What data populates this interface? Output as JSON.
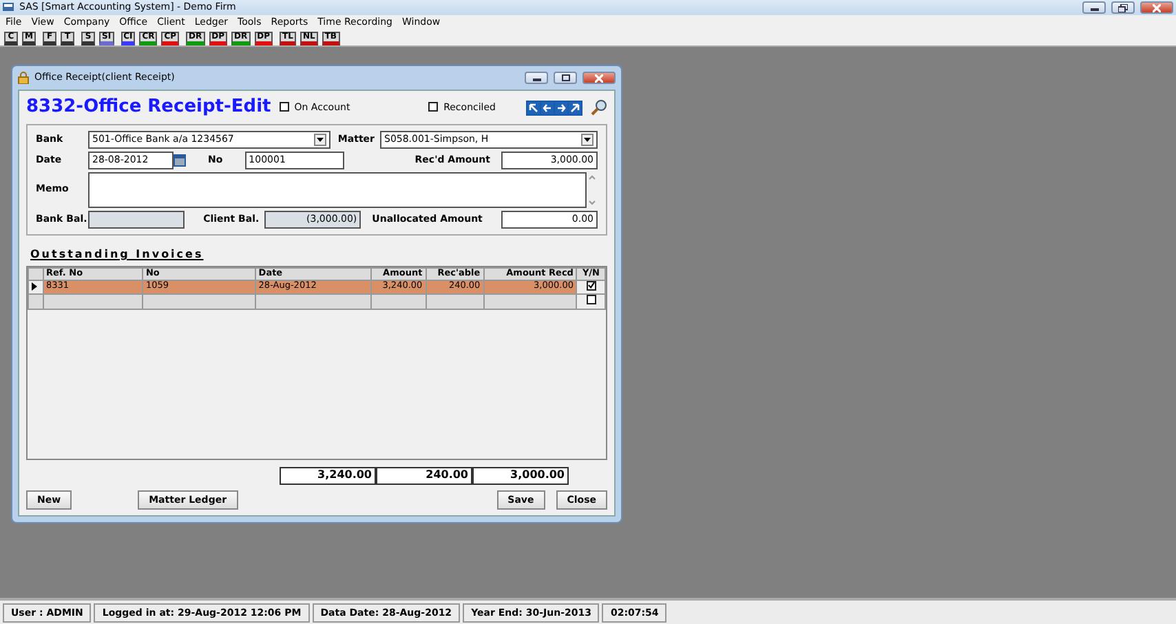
{
  "app_title": "SAS [Smart Accounting System] - Demo Firm",
  "menu": [
    "File",
    "View",
    "Company",
    "Office",
    "Client",
    "Ledger",
    "Tools",
    "Reports",
    "Time Recording",
    "Window"
  ],
  "toolbar_groups": [
    [
      {
        "label": "C",
        "color": "#333333"
      },
      {
        "label": "M",
        "color": "#333333"
      }
    ],
    [
      {
        "label": "F",
        "color": "#333333"
      },
      {
        "label": "T",
        "color": "#333333"
      }
    ],
    [
      {
        "label": "S",
        "color": "#333333"
      },
      {
        "label": "SI",
        "color": "#6a6ad0"
      }
    ],
    [
      {
        "label": "CI",
        "color": "#3a3aff"
      },
      {
        "label": "CR",
        "color": "#109a10"
      },
      {
        "label": "CP",
        "color": "#e01010"
      }
    ],
    [
      {
        "label": "DR",
        "color": "#109a10"
      },
      {
        "label": "DP",
        "color": "#e01010"
      },
      {
        "label": "DR",
        "color": "#109a10"
      },
      {
        "label": "DP",
        "color": "#e01010"
      }
    ],
    [
      {
        "label": "TL",
        "color": "#c01010"
      },
      {
        "label": "NL",
        "color": "#c01010"
      },
      {
        "label": "TB",
        "color": "#c01010"
      }
    ]
  ],
  "dialog": {
    "title": "Office Receipt(client Receipt)",
    "heading": "8332-Office Receipt-Edit",
    "on_account": {
      "label": "On Account",
      "checked": false
    },
    "reconciled": {
      "label": "Reconciled",
      "checked": false
    },
    "bank": {
      "label": "Bank",
      "value": "501-Office Bank a/a 1234567"
    },
    "matter": {
      "label": "Matter",
      "value": "S058.001-Simpson, H"
    },
    "date": {
      "label": "Date",
      "value": "28-08-2012"
    },
    "no": {
      "label": "No",
      "value": "100001"
    },
    "recd_amount": {
      "label": "Rec'd Amount",
      "value": "3,000.00"
    },
    "memo": {
      "label": "Memo"
    },
    "bank_bal": {
      "label": "Bank Bal."
    },
    "client_bal": {
      "label": "Client Bal.",
      "value": "(3,000.00)"
    },
    "unallocated": {
      "label": "Unallocated Amount",
      "value": "0.00"
    },
    "section_title": "Outstanding Invoices",
    "table": {
      "columns": [
        "Ref. No",
        "No",
        "Date",
        "Amount",
        "Rec'able",
        "Amount Recd",
        "Y/N"
      ],
      "rows": [
        {
          "cells": [
            "8331",
            "1059",
            "28-Aug-2012",
            "3,240.00",
            "240.00",
            "3,000.00"
          ],
          "checked": true,
          "selected": true
        },
        {
          "cells": [
            "",
            "",
            "",
            "",
            "",
            ""
          ],
          "checked": false,
          "selected": false
        }
      ]
    },
    "totals": [
      "3,240.00",
      "240.00",
      "3,000.00"
    ],
    "buttons_left": [
      "New",
      "Matter Ledger"
    ],
    "buttons_right": [
      "Save",
      "Close"
    ]
  },
  "status_bar": [
    "User : ADMIN",
    "Logged in at: 29-Aug-2012 12:06 PM",
    "Data Date: 28-Aug-2012",
    "Year End: 30-Jun-2013",
    "02:07:54"
  ]
}
